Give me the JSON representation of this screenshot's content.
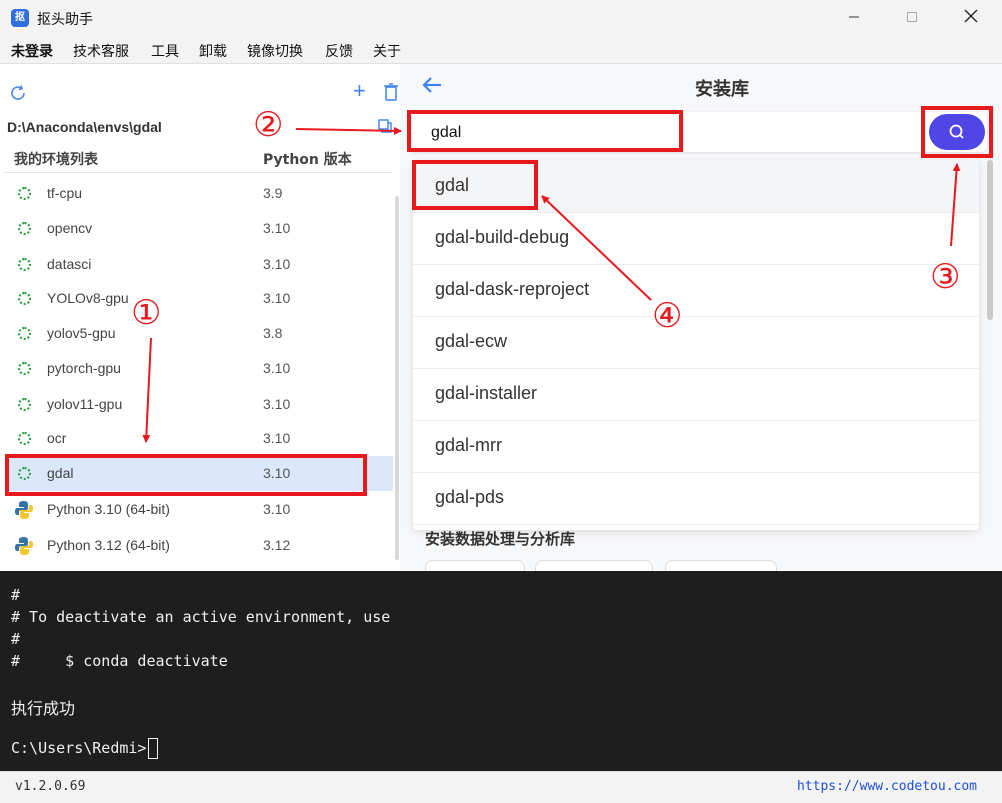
{
  "window": {
    "title": "抠头助手",
    "app_icon_text": "抠"
  },
  "menu": {
    "items": [
      "未登录",
      "技术客服",
      "工具",
      "卸载",
      "镜像切换",
      "反馈",
      "关于"
    ]
  },
  "left_panel": {
    "env_path": "D:\\Anaconda\\envs\\gdal",
    "col_env": "我的环境列表",
    "col_python": "Python 版本",
    "envs": [
      {
        "name": "tf-cpu",
        "version": "3.9",
        "icon": "conda-env-icon"
      },
      {
        "name": "opencv",
        "version": "3.10",
        "icon": "conda-env-icon"
      },
      {
        "name": "datasci",
        "version": "3.10",
        "icon": "conda-env-icon"
      },
      {
        "name": "YOLOv8-gpu",
        "version": "3.10",
        "icon": "conda-env-icon"
      },
      {
        "name": "yolov5-gpu",
        "version": "3.8",
        "icon": "conda-env-icon"
      },
      {
        "name": "pytorch-gpu",
        "version": "3.10",
        "icon": "conda-env-icon"
      },
      {
        "name": "yolov11-gpu",
        "version": "3.10",
        "icon": "conda-env-icon"
      },
      {
        "name": "ocr",
        "version": "3.10",
        "icon": "conda-env-icon"
      },
      {
        "name": "gdal",
        "version": "3.10",
        "icon": "conda-env-icon"
      },
      {
        "name": "Python 3.10 (64-bit)",
        "version": "3.10",
        "icon": "python-icon"
      },
      {
        "name": "Python 3.12 (64-bit)",
        "version": "3.12",
        "icon": "python-icon"
      }
    ],
    "selected_env": "gdal"
  },
  "right_panel": {
    "title": "安装库",
    "search_value": "gdal",
    "suggestions": [
      "gdal",
      "gdal-build-debug",
      "gdal-dask-reproject",
      "gdal-ecw",
      "gdal-installer",
      "gdal-mrr",
      "gdal-pds"
    ],
    "section_heading_partial": "安装数据处理与分析库"
  },
  "console": {
    "lines": [
      "#",
      "# To deactivate an active environment, use",
      "#",
      "#     $ conda deactivate",
      "",
      "执行成功",
      "",
      "C:\\Users\\Redmi>"
    ]
  },
  "status": {
    "version": "v1.2.0.69",
    "website": "https://www.codetou.com"
  },
  "annotations": {
    "step1": "①",
    "step2": "②",
    "step3": "③",
    "step4": "④",
    "color": "#e8191c"
  },
  "colors": {
    "accent": "#4f46e5",
    "selected_row": "#dbe8fb",
    "env_icon": "#22a03c",
    "console_bg": "#1e1e1e"
  }
}
